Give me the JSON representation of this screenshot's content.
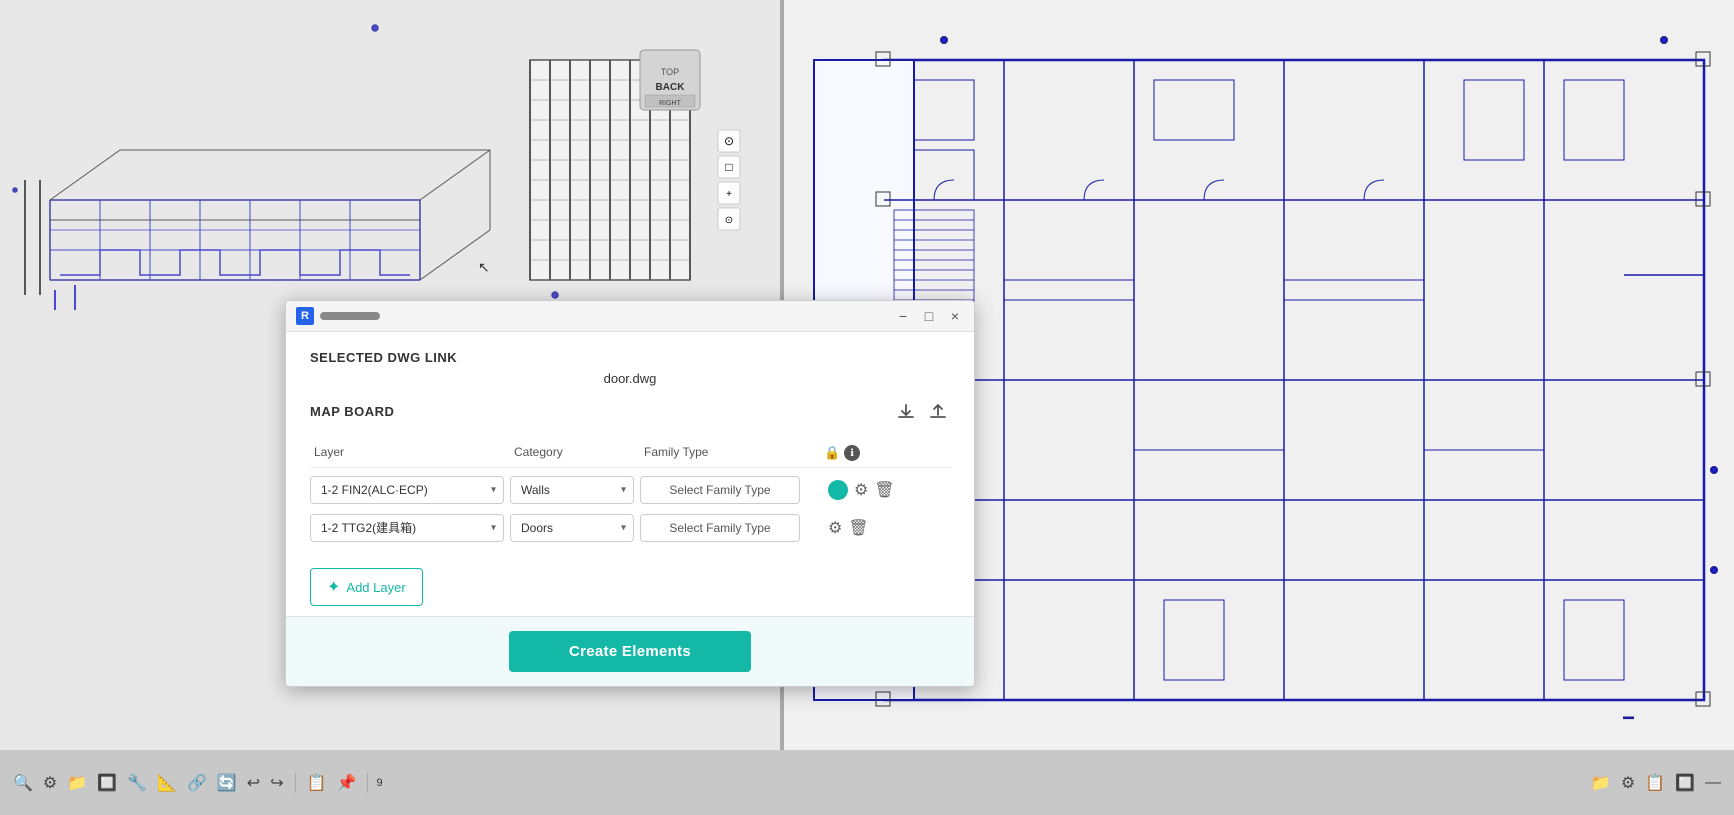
{
  "app": {
    "title": "Revit"
  },
  "viewport_left": {
    "bg": "#e8e8e8"
  },
  "viewport_right": {
    "bg": "#f0f0f0"
  },
  "modal": {
    "title_bar": {
      "app_icon": "R",
      "drag_bar": "drag",
      "minimize_label": "−",
      "maximize_label": "□",
      "close_label": "×"
    },
    "selected_dwg_link_label": "SELECTED DWG LINK",
    "file_name": "door.dwg",
    "map_board_label": "MAP BOARD",
    "download_icon": "⬇",
    "upload_icon": "⬆",
    "table_headers": {
      "layer": "Layer",
      "category": "Category",
      "family_type": "Family Type",
      "actions": ""
    },
    "info_icon": "ℹ",
    "rows": [
      {
        "id": "row1",
        "layer_value": "1-2 FIN2(ALC·ECP)",
        "category_value": "Walls",
        "family_type_placeholder": "Select Family Type",
        "has_color_dot": true,
        "color": "#14b8a6"
      },
      {
        "id": "row2",
        "layer_value": "1-2 TTG2(建具箱)",
        "category_value": "Doors",
        "family_type_placeholder": "Select Family Type",
        "has_color_dot": false,
        "color": null
      }
    ],
    "layer_options": [
      "1-2 FIN2(ALC·ECP)",
      "1-2 TTG2(建具箱)"
    ],
    "category_options_row1": [
      "Walls"
    ],
    "category_options_row2": [
      "Doors"
    ],
    "add_layer_label": "Add Layer",
    "add_layer_icon": "✦",
    "create_elements_label": "Create Elements"
  },
  "bottom_toolbar": {
    "left_icons": [
      "🔍",
      "⚙",
      "📁",
      "🔲",
      "🔧",
      "📐",
      "🔗",
      "🔄",
      "↩",
      "↪",
      "📋",
      "📌"
    ],
    "page_info": "9",
    "right_icons": [
      "📁",
      "⚙",
      "📋",
      "🔲",
      "—"
    ]
  },
  "nav_cube": {
    "label": "BACK"
  }
}
